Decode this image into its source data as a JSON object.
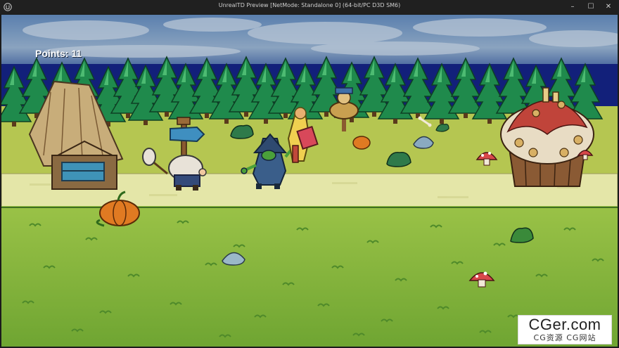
{
  "window": {
    "title": "UnrealTD Preview [NetMode: Standalone 0]  (64-bit/PC D3D SM6)",
    "controls": {
      "minimize": "–",
      "maximize": "☐",
      "close": "✕"
    }
  },
  "hud": {
    "points_label": "Points: 11"
  },
  "watermark": {
    "brand": "CGer.com",
    "sub": "CG资源 CG网站"
  },
  "scene": {
    "icons": [
      "hut",
      "signpost",
      "warrior-hero",
      "goblin-enemy",
      "hammer-enemy",
      "scarecrow",
      "cupcake-house",
      "pumpkin",
      "mushroom",
      "rock",
      "bush",
      "bone"
    ],
    "colors": {
      "sky": "#5f86b0",
      "sea": "#12207a",
      "grass": "#86b83a",
      "path": "#e4e6a8",
      "tree": "#1c8a4a"
    }
  }
}
